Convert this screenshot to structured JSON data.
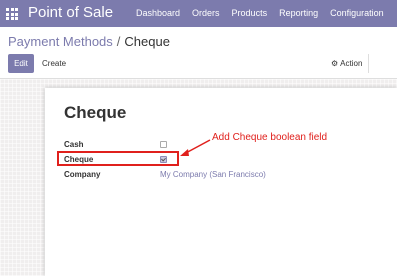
{
  "app": {
    "title": "Point of Sale",
    "menu": [
      "Dashboard",
      "Orders",
      "Products",
      "Reporting",
      "Configuration"
    ]
  },
  "breadcrumb": {
    "parent": "Payment Methods",
    "separator": "/",
    "current": "Cheque"
  },
  "toolbar": {
    "edit_label": "Edit",
    "create_label": "Create",
    "action_label": "Action"
  },
  "record": {
    "title": "Cheque",
    "fields": {
      "cash_label": "Cash",
      "cash_checked": false,
      "cheque_label": "Cheque",
      "cheque_checked": true,
      "company_label": "Company",
      "company_value": "My Company (San Francisco)"
    }
  },
  "annotation": {
    "text": "Add Cheque boolean field",
    "color": "#e0201c"
  },
  "colors": {
    "brand": "#7c7bad"
  }
}
